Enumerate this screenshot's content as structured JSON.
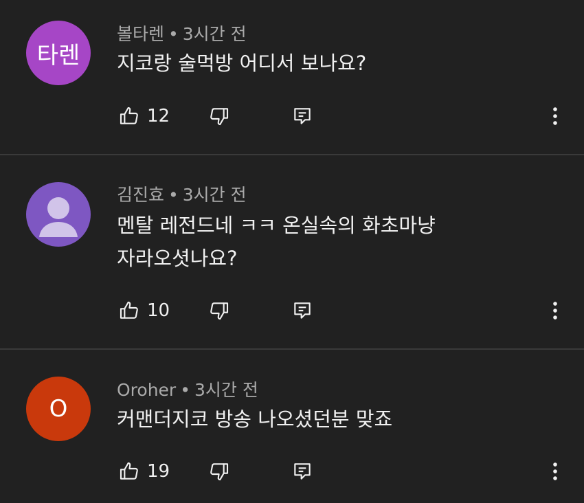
{
  "comments": [
    {
      "author": "볼타렌",
      "time": "3시간 전",
      "lines": [
        "지코랑 술먹방 어디서 보나요?"
      ],
      "avatar_text": "타렌",
      "avatar_color": "#a646c6",
      "likes": "12"
    },
    {
      "author": "김진효",
      "time": "3시간 전",
      "lines": [
        "멘탈 레전드네 ㅋㅋ 온실속의 화초마냥",
        "자라오셧나요?"
      ],
      "avatar_text": "",
      "avatar_color": "#7e57c2",
      "likes": "10"
    },
    {
      "author": "Oroher",
      "time": "3시간 전",
      "lines": [
        "커맨더지코 방송 나오셨던분 맞죠"
      ],
      "avatar_text": "O",
      "avatar_color": "#c9390c",
      "likes": "19"
    }
  ],
  "separator": "•",
  "icons": {
    "like": "thumbs-up-icon",
    "dislike": "thumbs-down-icon",
    "reply": "reply-icon",
    "more": "more-vertical-icon"
  }
}
